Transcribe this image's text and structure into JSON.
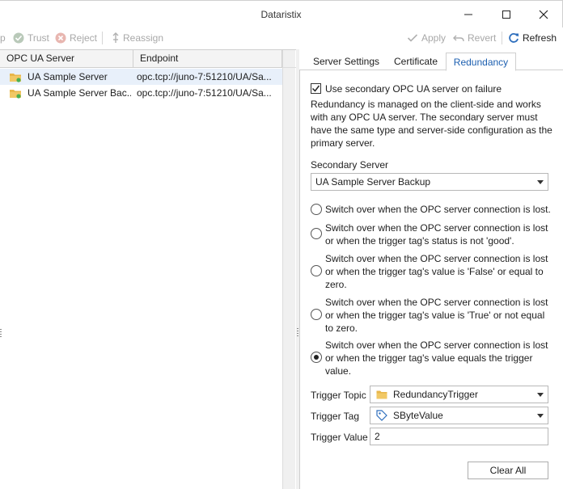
{
  "window": {
    "title": "Dataristix"
  },
  "toolbar": {
    "partial_label": "p",
    "trust_label": "Trust",
    "reject_label": "Reject",
    "reassign_label": "Reassign",
    "apply_label": "Apply",
    "revert_label": "Revert",
    "refresh_label": "Refresh"
  },
  "grid": {
    "columns": [
      "OPC UA Server",
      "Endpoint"
    ],
    "rows": [
      {
        "server": "UA Sample Server",
        "endpoint": "opc.tcp://juno-7:51210/UA/Sa..."
      },
      {
        "server": "UA Sample Server Bac...",
        "endpoint": "opc.tcp://juno-7:51210/UA/Sa..."
      }
    ]
  },
  "tabs": [
    "Server Settings",
    "Certificate",
    "Redundancy"
  ],
  "redundancy": {
    "use_secondary_label": "Use secondary OPC UA server on failure",
    "use_secondary_checked": true,
    "description": "Redundancy is managed on the client-side and works with any OPC UA server. The secondary server must have the same type and server-side configuration as the primary server.",
    "secondary_server_label": "Secondary Server",
    "secondary_server_value": "UA Sample Server Backup",
    "options": [
      "Switch over when the OPC server connection is lost.",
      "Switch over when the OPC server connection is lost or when the trigger tag's status is not 'good'.",
      "Switch over when the OPC server connection is lost or when the trigger tag's value is 'False' or equal to zero.",
      "Switch over when the OPC server connection is lost or when the trigger tag's value is 'True' or not equal to zero.",
      "Switch over when the OPC server connection is lost or when the trigger tag's value equals the trigger value."
    ],
    "selected_option": 4,
    "trigger_topic_label": "Trigger Topic",
    "trigger_topic_value": "RedundancyTrigger",
    "trigger_tag_label": "Trigger Tag",
    "trigger_tag_value": "SByteValue",
    "trigger_value_label": "Trigger Value",
    "trigger_value": "2",
    "clear_all_label": "Clear All"
  },
  "colors": {
    "accent": "#1c5fb0",
    "selected_row": "#e8f0fa",
    "folder": "#e8b64a"
  }
}
